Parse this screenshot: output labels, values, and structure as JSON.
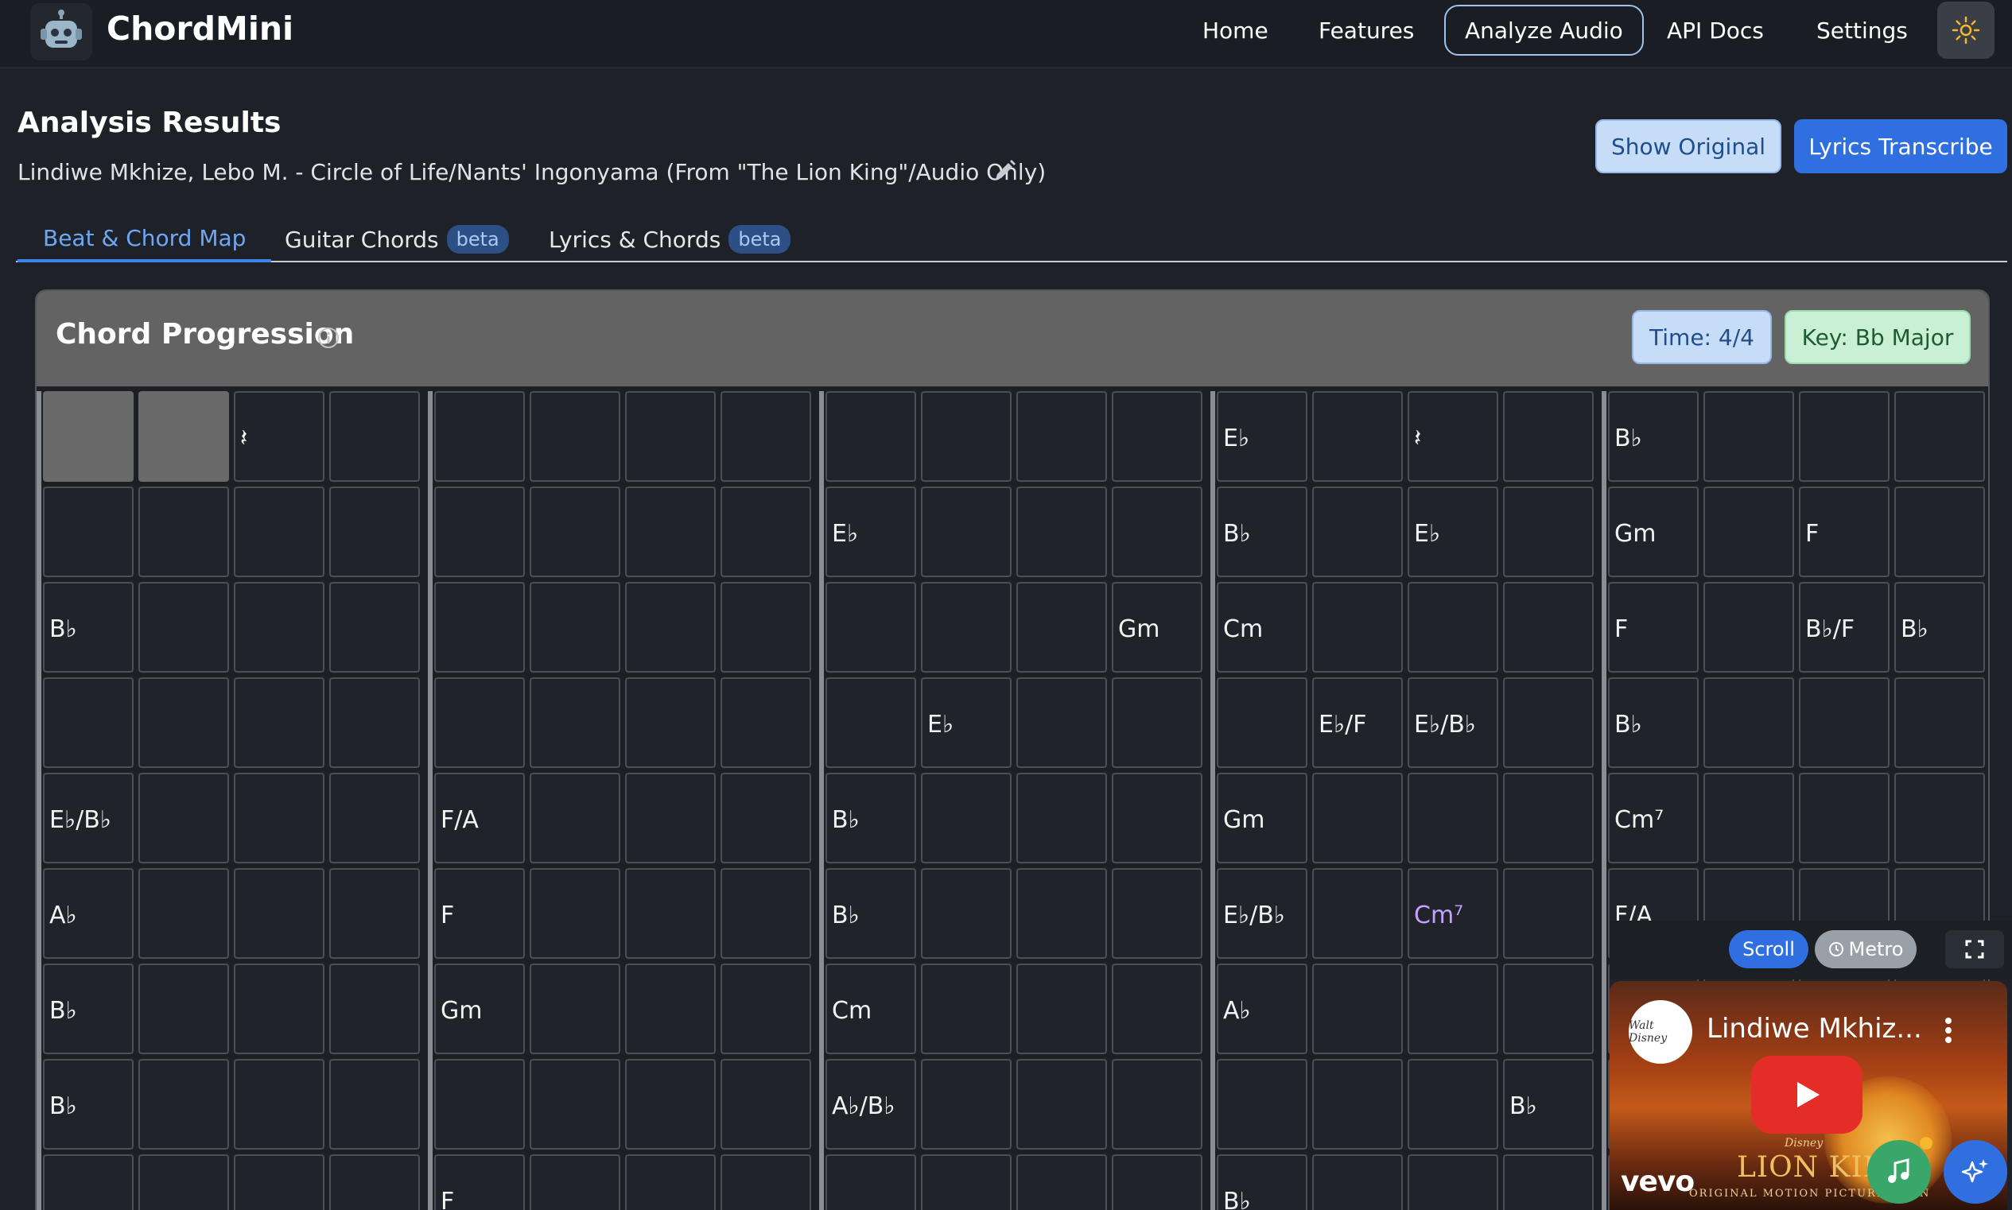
{
  "header": {
    "brand": "ChordMini",
    "nav": [
      {
        "label": "Home"
      },
      {
        "label": "Features"
      },
      {
        "label": "Analyze Audio"
      },
      {
        "label": "API Docs"
      },
      {
        "label": "Settings"
      }
    ]
  },
  "page": {
    "title": "Analysis Results",
    "song_title": "Lindiwe Mkhize, Lebo M. - Circle of Life/Nants' Ingonyama (From \"The Lion King\"/Audio Only)",
    "show_original": "Show Original",
    "lyrics_transcribe": "Lyrics Transcribe"
  },
  "tabs": [
    {
      "label": "Beat & Chord Map",
      "badge": ""
    },
    {
      "label": "Guitar Chords",
      "badge": "beta"
    },
    {
      "label": "Lyrics & Chords",
      "badge": "beta"
    }
  ],
  "chord_panel": {
    "title": "Chord Progression",
    "time": "Time: 4/4",
    "key": "Key: Bb Major",
    "rows": [
      [
        "",
        "",
        "𝄽",
        "",
        "",
        "",
        "",
        "",
        "",
        "",
        "",
        "",
        "E♭",
        "",
        "𝄽",
        "",
        "B♭",
        "",
        "",
        ""
      ],
      [
        "",
        "",
        "",
        "",
        "",
        "",
        "",
        "",
        "E♭",
        "",
        "",
        "",
        "B♭",
        "",
        "E♭",
        "",
        "Gm",
        "",
        "F",
        ""
      ],
      [
        "B♭",
        "",
        "",
        "",
        "",
        "",
        "",
        "",
        "",
        "",
        "",
        "Gm",
        "Cm",
        "",
        "",
        "",
        "F",
        "",
        "B♭/F",
        "B♭"
      ],
      [
        "",
        "",
        "",
        "",
        "",
        "",
        "",
        "",
        "",
        "E♭",
        "",
        "",
        "",
        "E♭/F",
        "E♭/B♭",
        "",
        "B♭",
        "",
        "",
        ""
      ],
      [
        "E♭/B♭",
        "",
        "",
        "",
        "F/A",
        "",
        "",
        "",
        "B♭",
        "",
        "",
        "",
        "Gm",
        "",
        "",
        "",
        "Cm⁷",
        "",
        "",
        ""
      ],
      [
        "A♭",
        "",
        "",
        "",
        "F",
        "",
        "",
        "",
        "B♭",
        "",
        "",
        "",
        "E♭/B♭",
        "",
        "Cm⁷",
        "",
        "F/A",
        "",
        "",
        ""
      ],
      [
        "B♭",
        "",
        "",
        "",
        "Gm",
        "",
        "",
        "",
        "Cm",
        "",
        "",
        "",
        "A♭",
        "",
        "",
        "",
        "",
        "",
        "",
        ""
      ],
      [
        "B♭",
        "",
        "",
        "",
        "",
        "",
        "",
        "",
        "A♭/B♭",
        "",
        "",
        "",
        "",
        "",
        "",
        "B♭",
        "",
        "",
        "",
        ""
      ],
      [
        "",
        "",
        "",
        "",
        "F",
        "",
        "",
        "",
        "",
        "",
        "",
        "",
        "B♭",
        "",
        "",
        "",
        "",
        "",
        "",
        ""
      ]
    ],
    "shaded_cells": [
      [
        0,
        0
      ],
      [
        0,
        1
      ]
    ],
    "highlighted_cells": [
      [
        5,
        14
      ]
    ]
  },
  "video": {
    "scroll": "Scroll",
    "metro": "Metro",
    "title": "Lindiwe Mkhiz...",
    "channel_avatar": "Walt Disney",
    "logo": "vevo",
    "poster_studio": "Disney",
    "poster_title": "LION KING",
    "poster_subtitle": "ORIGINAL MOTION PICTURE SOUN"
  },
  "colors": {
    "accent": "#2f6fe0",
    "background": "#1e2228",
    "highlight_chord": "#c6a0ff",
    "key_pill": "#c9efd4",
    "time_pill": "#c6dcf7"
  }
}
